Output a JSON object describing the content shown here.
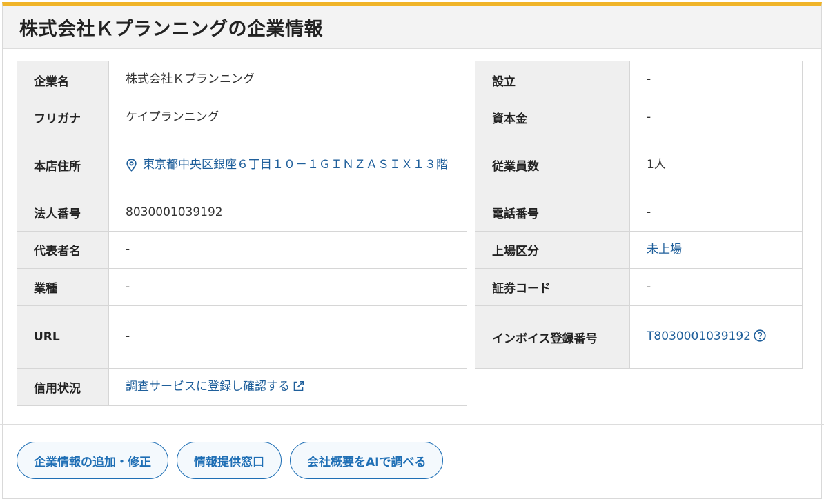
{
  "title": "株式会社Ｋプランニングの企業情報",
  "left_rows": [
    {
      "label": "企業名",
      "value": "株式会社Ｋプランニング"
    },
    {
      "label": "フリガナ",
      "value": "ケイプランニング"
    },
    {
      "label": "本店住所",
      "value": "東京都中央区銀座６丁目１０－１ＧＩＮＺＡＳＩＸ１３階"
    },
    {
      "label": "法人番号",
      "value": "8030001039192"
    },
    {
      "label": "代表者名",
      "value": "-"
    },
    {
      "label": "業種",
      "value": "-"
    },
    {
      "label": "URL",
      "value": "-"
    },
    {
      "label": "信用状況",
      "value": "調査サービスに登録し確認する"
    }
  ],
  "right_rows": [
    {
      "label": "設立",
      "value": "-"
    },
    {
      "label": "資本金",
      "value": "-"
    },
    {
      "label": "従業員数",
      "value": "1人"
    },
    {
      "label": "電話番号",
      "value": "-"
    },
    {
      "label": "上場区分",
      "value": "未上場"
    },
    {
      "label": "証券コード",
      "value": "-"
    },
    {
      "label": "インボイス登録番号",
      "value": "T8030001039192"
    }
  ],
  "buttons": {
    "edit": "企業情報の追加・修正",
    "contact": "情報提供窓口",
    "ai": "会社概要をAIで調べる"
  },
  "icons": {
    "address": "map-pin-icon",
    "credit": "external-link-icon",
    "invoice": "question-circle-icon"
  },
  "colors": {
    "accent_top": "#f0b429",
    "link": "#1f5f9b",
    "button": "#1f6fb5"
  }
}
